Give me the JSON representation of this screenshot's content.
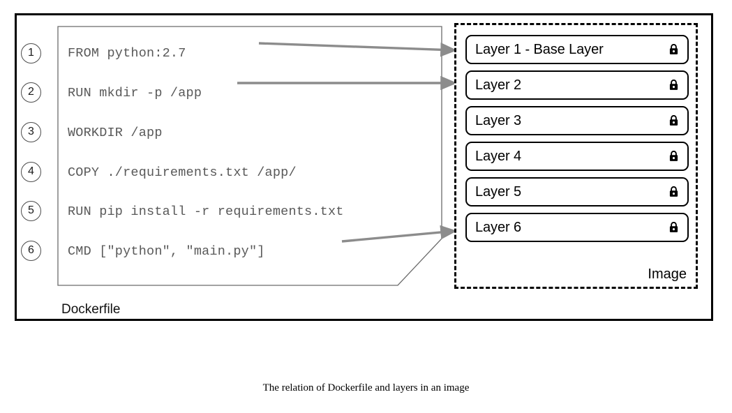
{
  "figure": {
    "caption": "The relation of Dockerfile and layers in an image"
  },
  "dockerfile": {
    "label": "Dockerfile",
    "lines": [
      {
        "number": "1",
        "code": "FROM python:2.7"
      },
      {
        "number": "2",
        "code": "RUN mkdir -p /app"
      },
      {
        "number": "3",
        "code": "WORKDIR /app"
      },
      {
        "number": "4",
        "code": "COPY ./requirements.txt /app/"
      },
      {
        "number": "5",
        "code": "RUN pip install -r requirements.txt"
      },
      {
        "number": "6",
        "code": "CMD [\"python\", \"main.py\"]"
      }
    ]
  },
  "image": {
    "label": "Image",
    "layers": [
      {
        "label": "Layer 1 - Base Layer",
        "icon": "lock-icon"
      },
      {
        "label": "Layer 2",
        "icon": "lock-icon"
      },
      {
        "label": "Layer 3",
        "icon": "lock-icon"
      },
      {
        "label": "Layer 4",
        "icon": "lock-icon"
      },
      {
        "label": "Layer 5",
        "icon": "lock-icon"
      },
      {
        "label": "Layer 6",
        "icon": "lock-icon"
      }
    ]
  },
  "connectors": [
    {
      "from": "line-1",
      "to": "layer-1"
    },
    {
      "from": "line-2",
      "to": "layer-2"
    },
    {
      "from": "line-6",
      "to": "layer-6"
    }
  ],
  "colors": {
    "frame": "#000000",
    "code_text": "#595959",
    "arrow": "#808080",
    "layer_border": "#000000",
    "dockerfile_border": "#4d4d4d"
  }
}
